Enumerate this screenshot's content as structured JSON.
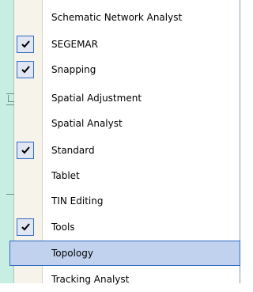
{
  "menu": {
    "items": [
      {
        "label": "Schematic Network Analyst",
        "checked": false,
        "highlighted": false
      },
      {
        "label": "SEGEMAR",
        "checked": true,
        "highlighted": false
      },
      {
        "label": "Snapping",
        "checked": true,
        "highlighted": false
      },
      {
        "label": "Spatial Adjustment",
        "checked": false,
        "highlighted": false
      },
      {
        "label": "Spatial Analyst",
        "checked": false,
        "highlighted": false
      },
      {
        "label": "Standard",
        "checked": true,
        "highlighted": false
      },
      {
        "label": "Tablet",
        "checked": false,
        "highlighted": false
      },
      {
        "label": "TIN Editing",
        "checked": false,
        "highlighted": false
      },
      {
        "label": "Tools",
        "checked": true,
        "highlighted": false
      },
      {
        "label": "Topology",
        "checked": false,
        "highlighted": true
      },
      {
        "label": "Tracking Analyst",
        "checked": false,
        "highlighted": false
      }
    ]
  },
  "colors": {
    "highlight_bg": "#c1d2ee",
    "highlight_border": "#316ac5",
    "check_bg": "#e1e6f3",
    "background_window": "#c6eee2"
  }
}
